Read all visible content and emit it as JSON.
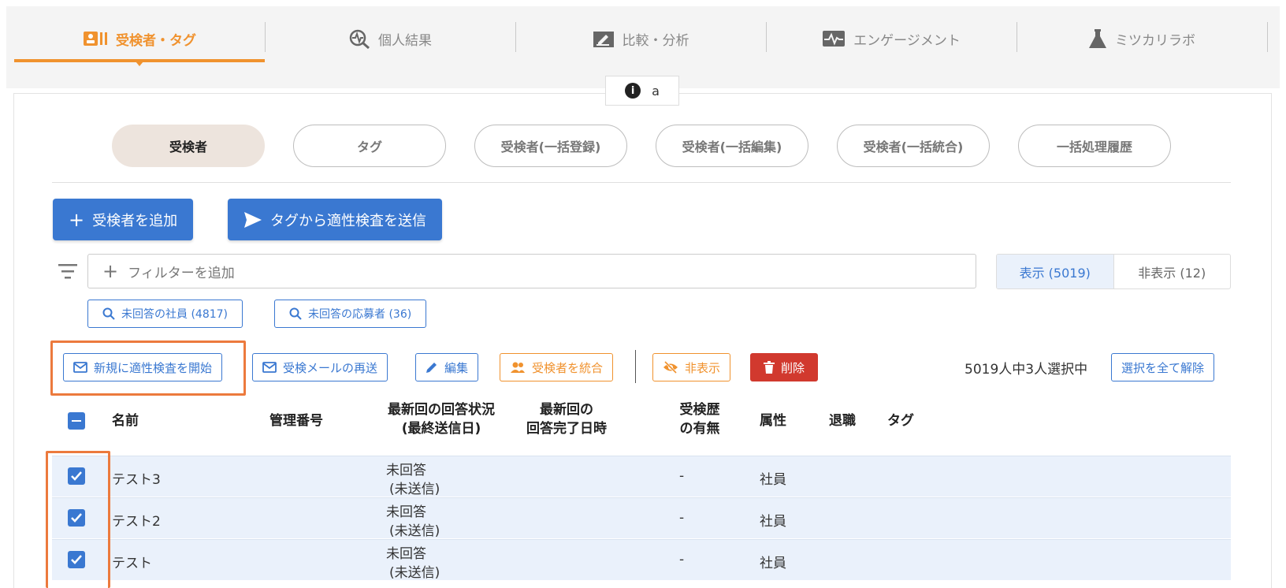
{
  "tabs": [
    {
      "label": "受検者・タグ",
      "icon": "person-card-icon",
      "active": true
    },
    {
      "label": "個人結果",
      "icon": "magnify-pulse-icon",
      "active": false
    },
    {
      "label": "比較・分析",
      "icon": "edit-chart-icon",
      "active": false
    },
    {
      "label": "エンゲージメント",
      "icon": "pulse-monitor-icon",
      "active": false
    },
    {
      "label": "ミツカリラボ",
      "icon": "flask-icon",
      "active": false
    }
  ],
  "info": {
    "label": "a"
  },
  "subtabs": [
    {
      "label": "受検者",
      "active": true
    },
    {
      "label": "タグ"
    },
    {
      "label": "受検者(一括登録)"
    },
    {
      "label": "受検者(一括編集)"
    },
    {
      "label": "受検者(一括統合)"
    },
    {
      "label": "一括処理履歴"
    }
  ],
  "primary": {
    "add": "受検者を追加",
    "send": "タグから適性検査を送信"
  },
  "filter": {
    "placeholder": "フィルターを追加",
    "show": "表示 (5019)",
    "hide": "非表示 (12)"
  },
  "chips": [
    "未回答の社員 (4817)",
    "未回答の応募者 (36)"
  ],
  "actions": {
    "start": "新規に適性検査を開始",
    "resend": "受検メールの再送",
    "edit": "編集",
    "merge": "受検者を統合",
    "hide": "非表示",
    "delete": "削除",
    "selection": "5019人中3人選択中",
    "clear": "選択を全て解除"
  },
  "table": {
    "headers": {
      "name": "名前",
      "number": "管理番号",
      "status_1": "最新回の回答状況",
      "status_2": "(最終送信日)",
      "completed_1": "最新回の",
      "completed_2": "回答完了日時",
      "history_1": "受検歴",
      "history_2": "の有無",
      "attr": "属性",
      "retire": "退職",
      "tag": "タグ"
    },
    "rows": [
      {
        "checked": true,
        "name": "テスト3",
        "status": "未回答",
        "sent": "(未送信)",
        "history": "-",
        "attr": "社員"
      },
      {
        "checked": true,
        "name": "テスト2",
        "status": "未回答",
        "sent": "(未送信)",
        "history": "-",
        "attr": "社員"
      },
      {
        "checked": true,
        "name": "テスト",
        "status": "未回答",
        "sent": "(未送信)",
        "history": "-",
        "attr": "社員"
      }
    ]
  },
  "colors": {
    "accent": "#f0922e",
    "primary": "#3a78d1",
    "danger": "#d1392e",
    "highlight": "#ec7a3d",
    "row_selected": "#eaf1fb"
  }
}
